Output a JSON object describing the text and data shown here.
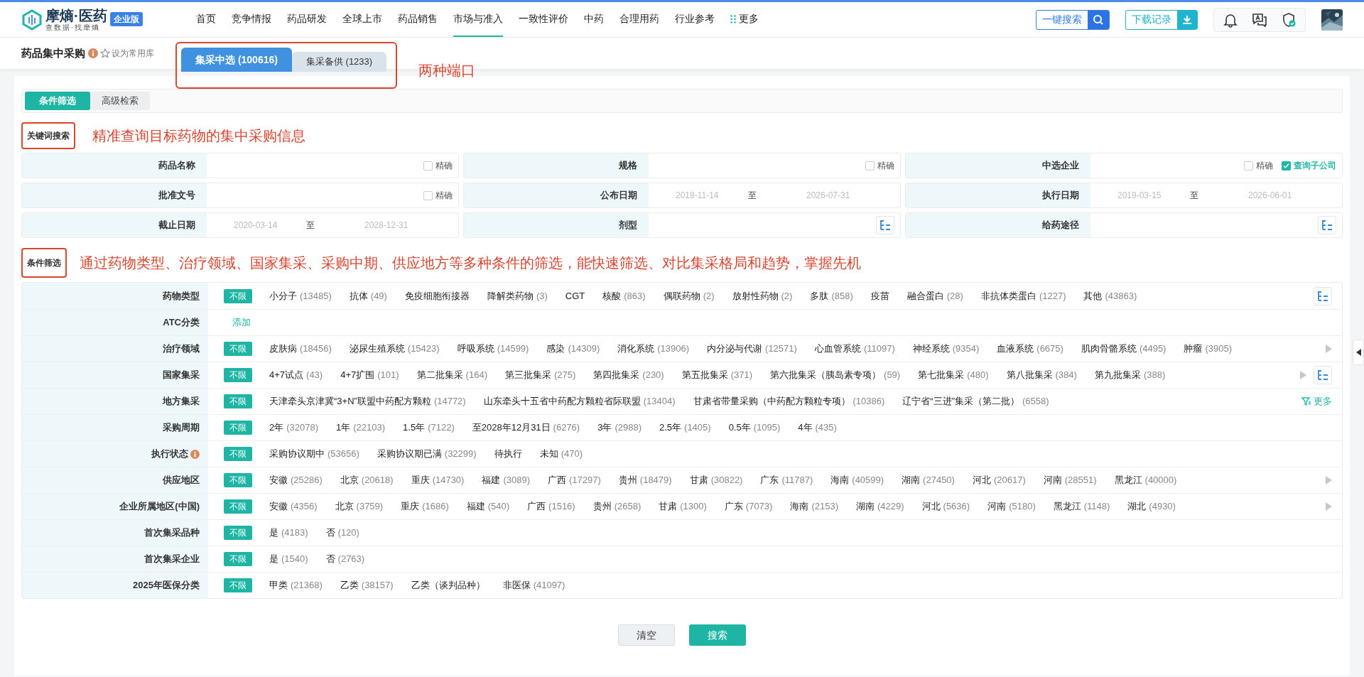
{
  "logo": {
    "name": "摩熵·医药",
    "slogan": "查数据·找摩熵",
    "badge": "企业版"
  },
  "nav": [
    {
      "label": "首页",
      "selected": false
    },
    {
      "label": "竞争情报",
      "selected": false
    },
    {
      "label": "药品研发",
      "selected": false
    },
    {
      "label": "全球上市",
      "selected": false
    },
    {
      "label": "药品销售",
      "selected": false
    },
    {
      "label": "市场与准入",
      "selected": true
    },
    {
      "label": "一致性评价",
      "selected": false
    },
    {
      "label": "中药",
      "selected": false
    },
    {
      "label": "合理用药",
      "selected": false
    },
    {
      "label": "行业参考",
      "selected": false
    }
  ],
  "nav_more": "更多",
  "header_actions": {
    "search": "一键搜索",
    "download": "下载记录"
  },
  "page": {
    "title": "药品集中采购",
    "favorite": "设为常用库"
  },
  "source_tabs": [
    {
      "label": "集采中选 (100616)",
      "selected": true
    },
    {
      "label": "集采备供 (1233)",
      "selected": false
    }
  ],
  "annotations": {
    "tabs_note": "两种端口",
    "keyword_note": "精准查询目标药物的集中采购信息",
    "filter_note": "通过药物类型、治疗领域、国家集采、采购中期、供应地方等多种条件的筛选，能快速筛选、对比集采格局和趋势，掌握先机"
  },
  "mode_tabs": [
    {
      "label": "条件筛选",
      "selected": true
    },
    {
      "label": "高级检索",
      "selected": false
    }
  ],
  "keyword_section": {
    "title": "关键词搜索",
    "fields": [
      {
        "label": "药品名称",
        "kind": "text",
        "exact": {
          "label": "精确",
          "checked": false
        }
      },
      {
        "label": "规格",
        "kind": "text",
        "exact": {
          "label": "精确",
          "checked": false
        }
      },
      {
        "label": "中选企业",
        "kind": "text",
        "exact": {
          "label": "精确",
          "checked": false
        },
        "subsidiary": {
          "label": "查询子公司",
          "checked": true
        }
      },
      {
        "label": "批准文号",
        "kind": "text",
        "exact": {
          "label": "精确",
          "checked": false
        }
      },
      {
        "label": "公布日期",
        "kind": "date_range",
        "start_placeholder": "2018-11-14",
        "separator": "至",
        "end_placeholder": "2026-07-31"
      },
      {
        "label": "执行日期",
        "kind": "date_range",
        "start_placeholder": "2019-03-15",
        "separator": "至",
        "end_placeholder": "2026-06-01"
      },
      {
        "label": "截止日期",
        "kind": "date_range",
        "start_placeholder": "2020-03-14",
        "separator": "至",
        "end_placeholder": "2028-12-31"
      },
      {
        "label": "剂型",
        "kind": "picker"
      },
      {
        "label": "给药途径",
        "kind": "picker"
      }
    ]
  },
  "filter_section": {
    "title": "条件筛选",
    "rows": [
      {
        "label": "药物类型",
        "kind": "options",
        "all": "不限",
        "tree_button": true,
        "options": [
          {
            "name": "小分子",
            "count": "(13485)"
          },
          {
            "name": "抗体",
            "count": "(49)"
          },
          {
            "name": "免疫细胞衔接器"
          },
          {
            "name": "降解类药物",
            "count": "(3)"
          },
          {
            "name": "CGT"
          },
          {
            "name": "核酸",
            "count": "(863)"
          },
          {
            "name": "偶联药物",
            "count": "(2)"
          },
          {
            "name": "放射性药物",
            "count": "(2)"
          },
          {
            "name": "多肽",
            "count": "(858)"
          },
          {
            "name": "疫苗"
          },
          {
            "name": "融合蛋白",
            "count": "(28)"
          },
          {
            "name": "非抗体类蛋白",
            "count": "(1227)"
          },
          {
            "name": "其他",
            "count": "(43863)"
          }
        ]
      },
      {
        "label": "ATC分类",
        "kind": "add",
        "add": "添加"
      },
      {
        "label": "治疗领域",
        "kind": "options",
        "all": "不限",
        "scroll_arrow": true,
        "options": [
          {
            "name": "皮肤病",
            "count": "(18456)"
          },
          {
            "name": "泌尿生殖系统",
            "count": "(15423)"
          },
          {
            "name": "呼吸系统",
            "count": "(14599)"
          },
          {
            "name": "感染",
            "count": "(14309)"
          },
          {
            "name": "消化系统",
            "count": "(13906)"
          },
          {
            "name": "内分泌与代谢",
            "count": "(12571)"
          },
          {
            "name": "心血管系统",
            "count": "(11097)"
          },
          {
            "name": "神经系统",
            "count": "(9354)"
          },
          {
            "name": "血液系统",
            "count": "(6675)"
          },
          {
            "name": "肌肉骨骼系统",
            "count": "(4495)"
          },
          {
            "name": "肿瘤",
            "count": "(3905)"
          }
        ]
      },
      {
        "label": "国家集采",
        "kind": "options",
        "all": "不限",
        "scroll_arrow": true,
        "tree_button": true,
        "options": [
          {
            "name": "4+7试点",
            "count": "(43)"
          },
          {
            "name": "4+7扩围",
            "count": "(101)"
          },
          {
            "name": "第二批集采",
            "count": "(164)"
          },
          {
            "name": "第三批集采",
            "count": "(275)"
          },
          {
            "name": "第四批集采",
            "count": "(230)"
          },
          {
            "name": "第五批集采",
            "count": "(371)"
          },
          {
            "name": "第六批集采（胰岛素专项）",
            "count": "(59)"
          },
          {
            "name": "第七批集采",
            "count": "(480)"
          },
          {
            "name": "第八批集采",
            "count": "(384)"
          },
          {
            "name": "第九批集采",
            "count": "(388)"
          }
        ]
      },
      {
        "label": "地方集采",
        "kind": "options",
        "all": "不限",
        "more": "更多",
        "options": [
          {
            "name": "天津牵头京津冀“3+N”联盟中药配方颗粒",
            "count": "(14772)"
          },
          {
            "name": "山东牵头十五省中药配方颗粒省际联盟",
            "count": "(13404)"
          },
          {
            "name": "甘肃省带量采购（中药配方颗粒专项）",
            "count": "(10386)"
          },
          {
            "name": "辽宁省“三进”集采（第二批）",
            "count": "(6558)"
          }
        ]
      },
      {
        "label": "采购周期",
        "kind": "options",
        "all": "不限",
        "options": [
          {
            "name": "2年",
            "count": "(32078)"
          },
          {
            "name": "1年",
            "count": "(22103)"
          },
          {
            "name": "1.5年",
            "count": "(7122)"
          },
          {
            "name": "至2028年12月31日",
            "count": "(6276)"
          },
          {
            "name": "3年",
            "count": "(2988)"
          },
          {
            "name": "2.5年",
            "count": "(1405)"
          },
          {
            "name": "0.5年",
            "count": "(1095)"
          },
          {
            "name": "4年",
            "count": "(435)"
          }
        ]
      },
      {
        "label": "执行状态",
        "kind": "options",
        "info": true,
        "all": "不限",
        "options": [
          {
            "name": "采购协议期中",
            "count": "(53656)"
          },
          {
            "name": "采购协议期已满",
            "count": "(32299)"
          },
          {
            "name": "待执行"
          },
          {
            "name": "未知",
            "count": "(470)"
          }
        ]
      },
      {
        "label": "供应地区",
        "kind": "options",
        "all": "不限",
        "scroll_arrow": true,
        "options": [
          {
            "name": "安徽",
            "count": "(25286)"
          },
          {
            "name": "北京",
            "count": "(20618)"
          },
          {
            "name": "重庆",
            "count": "(14730)"
          },
          {
            "name": "福建",
            "count": "(3089)"
          },
          {
            "name": "广西",
            "count": "(17297)"
          },
          {
            "name": "贵州",
            "count": "(18479)"
          },
          {
            "name": "甘肃",
            "count": "(30822)"
          },
          {
            "name": "广东",
            "count": "(11787)"
          },
          {
            "name": "海南",
            "count": "(40599)"
          },
          {
            "name": "湖南",
            "count": "(27450)"
          },
          {
            "name": "河北",
            "count": "(20617)"
          },
          {
            "name": "河南",
            "count": "(28551)"
          },
          {
            "name": "黑龙江",
            "count": "(40000)"
          }
        ]
      },
      {
        "label": "企业所属地区(中国)",
        "kind": "options",
        "all": "不限",
        "scroll_arrow": true,
        "options": [
          {
            "name": "安徽",
            "count": "(4356)"
          },
          {
            "name": "北京",
            "count": "(3759)"
          },
          {
            "name": "重庆",
            "count": "(1686)"
          },
          {
            "name": "福建",
            "count": "(540)"
          },
          {
            "name": "广西",
            "count": "(1516)"
          },
          {
            "name": "贵州",
            "count": "(2658)"
          },
          {
            "name": "甘肃",
            "count": "(1300)"
          },
          {
            "name": "广东",
            "count": "(7073)"
          },
          {
            "name": "海南",
            "count": "(2153)"
          },
          {
            "name": "湖南",
            "count": "(4229)"
          },
          {
            "name": "河北",
            "count": "(5636)"
          },
          {
            "name": "河南",
            "count": "(5180)"
          },
          {
            "name": "黑龙江",
            "count": "(1148)"
          },
          {
            "name": "湖北",
            "count": "(4930)"
          }
        ]
      },
      {
        "label": "首次集采品种",
        "kind": "options",
        "all": "不限",
        "options": [
          {
            "name": "是",
            "count": "(4183)"
          },
          {
            "name": "否",
            "count": "(120)"
          }
        ]
      },
      {
        "label": "首次集采企业",
        "kind": "options",
        "all": "不限",
        "options": [
          {
            "name": "是",
            "count": "(1540)"
          },
          {
            "name": "否",
            "count": "(2763)"
          }
        ]
      },
      {
        "label": "2025年医保分类",
        "kind": "options",
        "all": "不限",
        "options": [
          {
            "name": "甲类",
            "count": "(21368)"
          },
          {
            "name": "乙类",
            "count": "(38157)"
          },
          {
            "name": "乙类（谈判品种）"
          },
          {
            "name": "非医保",
            "count": "(41097)"
          }
        ]
      }
    ]
  },
  "buttons": {
    "clear": "清空",
    "search": "搜索"
  }
}
